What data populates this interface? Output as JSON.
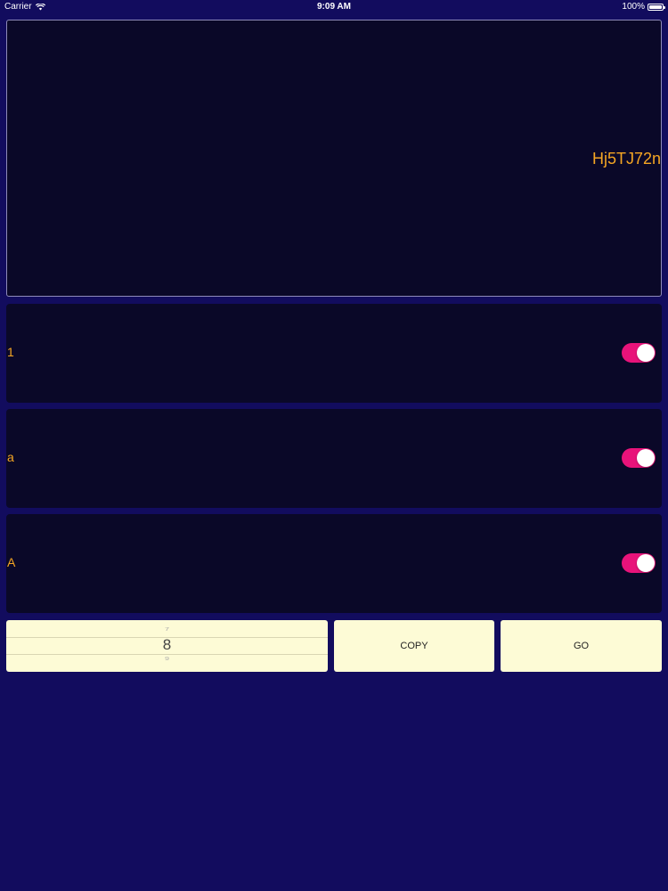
{
  "status_bar": {
    "carrier": "Carrier",
    "time": "9:09 AM",
    "battery": "100%",
    "battery_level": 1.0
  },
  "display": {
    "password": "Hj5TJ72n"
  },
  "options": [
    {
      "label": "1",
      "enabled": true
    },
    {
      "label": "a",
      "enabled": true
    },
    {
      "label": "A",
      "enabled": true
    }
  ],
  "length_picker": {
    "prev": "7",
    "current": "8",
    "next": "9"
  },
  "buttons": {
    "copy_label": "COPY",
    "go_label": "GO"
  },
  "colors": {
    "background": "#120c5e",
    "panel": "#0a0828",
    "accent_text": "#f5a623",
    "toggle_on": "#e8137a",
    "button_bg": "#fdfbd6"
  }
}
